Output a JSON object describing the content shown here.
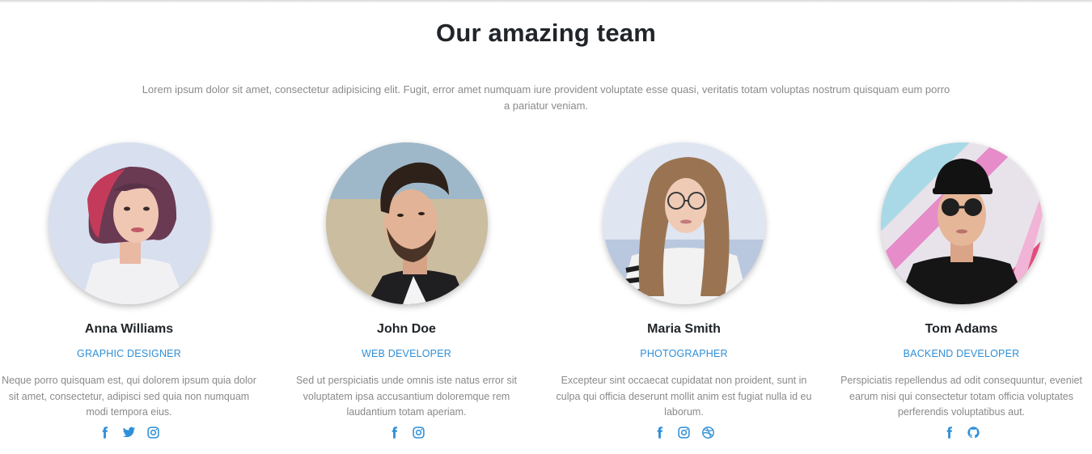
{
  "section": {
    "title": "Our amazing team",
    "intro": "Lorem ipsum dolor sit amet, consectetur adipisicing elit. Fugit, error amet numquam iure provident voluptate esse quasi, veritatis totam voluptas nostrum quisquam eum porro a pariatur veniam."
  },
  "colors": {
    "accent": "#2f8fd8",
    "heading": "#212529",
    "muted": "#8a8a8a"
  },
  "members": [
    {
      "name": "Anna Williams",
      "role": "GRAPHIC DESIGNER",
      "description": "Neque porro quisquam est, qui dolorem ipsum quia dolor sit amet, consectetur, adipisci sed quia non numquam modi tempora eius.",
      "socials": [
        "facebook-icon",
        "twitter-icon",
        "instagram-icon"
      ]
    },
    {
      "name": "John Doe",
      "role": "WEB DEVELOPER",
      "description": "Sed ut perspiciatis unde omnis iste natus error sit voluptatem ipsa accusantium doloremque rem laudantium totam aperiam.",
      "socials": [
        "facebook-icon",
        "instagram-icon"
      ]
    },
    {
      "name": "Maria Smith",
      "role": "PHOTOGRAPHER",
      "description": "Excepteur sint occaecat cupidatat non proident, sunt in culpa qui officia deserunt mollit anim est fugiat nulla id eu laborum.",
      "socials": [
        "facebook-icon",
        "instagram-icon",
        "dribbble-icon"
      ]
    },
    {
      "name": "Tom Adams",
      "role": "BACKEND DEVELOPER",
      "description": "Perspiciatis repellendus ad odit consequuntur, eveniet earum nisi qui consectetur totam officia voluptates perferendis voluptatibus aut.",
      "socials": [
        "facebook-icon",
        "github-icon"
      ]
    }
  ]
}
